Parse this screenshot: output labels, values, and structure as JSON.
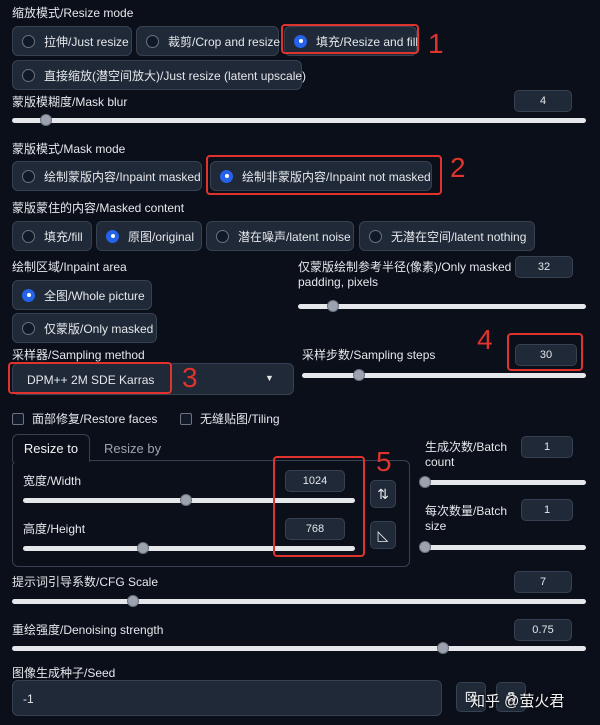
{
  "resize_mode": {
    "label": "缩放模式/Resize mode",
    "options": [
      "拉伸/Just resize",
      "裁剪/Crop and resize",
      "填充/Resize and fill",
      "直接缩放(潜空间放大)/Just resize (latent upscale)"
    ],
    "selected": "填充/Resize and fill"
  },
  "mask_blur": {
    "label": "蒙版模糊度/Mask blur",
    "value": "4",
    "level": 0.06
  },
  "mask_mode": {
    "label": "蒙版模式/Mask mode",
    "options": [
      "绘制蒙版内容/Inpaint masked",
      "绘制非蒙版内容/Inpaint not masked"
    ],
    "selected": "绘制非蒙版内容/Inpaint not masked"
  },
  "masked_content": {
    "label": "蒙版蒙住的内容/Masked content",
    "options": [
      "填充/fill",
      "原图/original",
      "潜在噪声/latent noise",
      "无潜在空间/latent nothing"
    ],
    "selected": "原图/original"
  },
  "inpaint_area": {
    "label": "绘制区域/Inpaint area",
    "options": [
      "全图/Whole picture",
      "仅蒙版/Only masked"
    ],
    "selected": "全图/Whole picture"
  },
  "padding": {
    "label_line1": "仅蒙版绘制参考半径(像素)/Only masked",
    "label_line2": "padding, pixels",
    "value": "32",
    "level": 0.12
  },
  "sampler": {
    "label": "采样器/Sampling method",
    "value": "DPM++ 2M SDE Karras",
    "caret": "▼"
  },
  "steps": {
    "label": "采样步数/Sampling steps",
    "value": "30",
    "level": 0.2
  },
  "checkboxes": {
    "restore_faces": "面部修复/Restore faces",
    "tiling": "无缝贴图/Tiling"
  },
  "tabs": {
    "resize_to": "Resize to",
    "resize_by": "Resize by"
  },
  "width": {
    "label": "宽度/Width",
    "value": "1024",
    "level": 0.5
  },
  "height": {
    "label": "高度/Height",
    "value": "768",
    "level": 0.37
  },
  "swap_icon": "⇅",
  "ratio_icon": "◺",
  "batch_count": {
    "label_line1": "生成次数/Batch",
    "label_line2": "count",
    "value": "1",
    "level": 0.0
  },
  "batch_size": {
    "label_line1": "每次数量/Batch",
    "label_line2": "size",
    "value": "1",
    "level": 0.0
  },
  "cfg": {
    "label": "提示词引导系数/CFG Scale",
    "value": "7",
    "level": 0.2
  },
  "denoise": {
    "label": "重绘强度/Denoising strength",
    "value": "0.75",
    "level": 0.75
  },
  "seed": {
    "label": "图像生成种子/Seed",
    "value": "-1"
  },
  "annotations": [
    "1",
    "2",
    "3",
    "4",
    "5"
  ],
  "watermark": "知乎 @萤火君",
  "colors": {
    "background": "#0b0f19",
    "accent": "#2563eb",
    "annotation_red": "#e0332d"
  }
}
